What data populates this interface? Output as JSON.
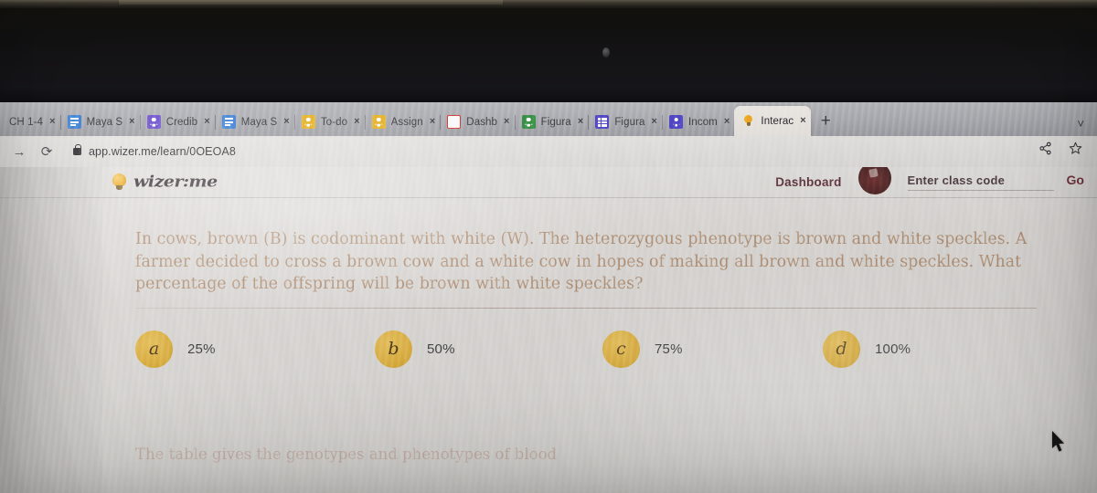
{
  "browser": {
    "tabs": [
      {
        "label": "CH 1-4",
        "favicon": "none",
        "active": false
      },
      {
        "label": "Maya S",
        "favicon": "doc-icon",
        "active": false
      },
      {
        "label": "Credib",
        "favicon": "classroom-person-icon",
        "active": false
      },
      {
        "label": "Maya S",
        "favicon": "doc-icon",
        "active": false
      },
      {
        "label": "To-do",
        "favicon": "person-yellow-icon",
        "active": false
      },
      {
        "label": "Assign",
        "favicon": "person-yellow-icon",
        "active": false
      },
      {
        "label": "Dashb",
        "favicon": "m-icon",
        "active": false
      },
      {
        "label": "Figura",
        "favicon": "person-green-icon",
        "active": false
      },
      {
        "label": "Figura",
        "favicon": "spreadsheet-icon",
        "active": false
      },
      {
        "label": "Incom",
        "favicon": "person-blue-icon",
        "active": false
      },
      {
        "label": "Interac",
        "favicon": "lightbulb-icon",
        "active": true
      }
    ],
    "new_tab_label": "+",
    "tab_close_label": "×",
    "tab_list_chevron": "˅",
    "forward_label": "→",
    "reload_label": "⟳",
    "url": "app.wizer.me/learn/0OEOA8",
    "toolbar_icons": [
      "share-icon",
      "bookmark-star-icon"
    ]
  },
  "site_header": {
    "brand": "wizer:me",
    "brand_icon": "lightbulb-icon",
    "dashboard_label": "Dashboard",
    "avatar": "user-avatar",
    "class_code_placeholder": "Enter class code",
    "class_code_value": "",
    "go_label": "Go"
  },
  "worksheet": {
    "question": "In cows, brown (B) is codominant with white (W). The heterozygous phenotype is brown and white speckles. A farmer decided to cross a brown cow and a white cow in hopes of making all brown and white speckles. What percentage of the offspring will be brown with white speckles?",
    "options": [
      {
        "key": "a",
        "text": "25%"
      },
      {
        "key": "b",
        "text": "50%"
      },
      {
        "key": "c",
        "text": "75%"
      },
      {
        "key": "d",
        "text": "100%"
      }
    ],
    "next_question_preview": "The table gives the genotypes and phenotypes of blood"
  },
  "colors": {
    "option_bubble": "#dfae3d",
    "question_text": "#b08b6e",
    "brand_accent": "#e9a01a",
    "dashboard_link": "#5a3038",
    "go_button": "#6a2f38"
  }
}
